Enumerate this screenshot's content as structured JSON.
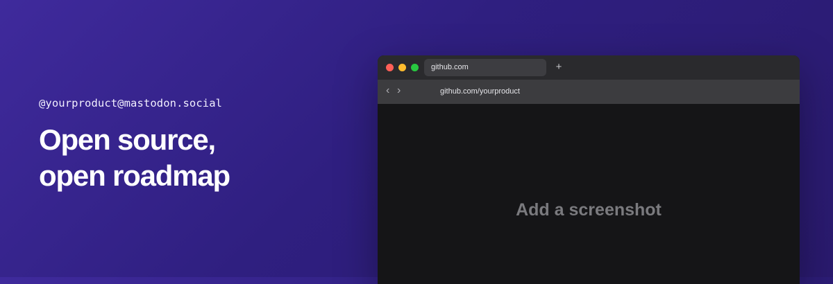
{
  "hero": {
    "handle": "@yourproduct@mastodon.social",
    "headline_line1": "Open source,",
    "headline_line2": "open roadmap"
  },
  "browser": {
    "traffic_lights": {
      "close": "#ff5f57",
      "minimize": "#febc2e",
      "maximize": "#28c840"
    },
    "tab_title": "github.com",
    "new_tab_icon": "+",
    "back_icon": "‹",
    "forward_icon": "›",
    "url": "github.com/yourproduct",
    "placeholder_text": "Add a screenshot"
  },
  "colors": {
    "background_gradient_start": "#3f2a9c",
    "background_gradient_end": "#2a1a6e"
  }
}
